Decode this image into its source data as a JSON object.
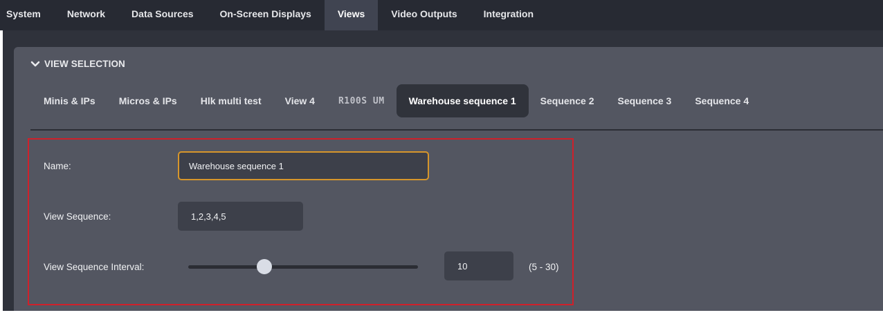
{
  "topnav": {
    "tabs": [
      {
        "label": "System",
        "active": false
      },
      {
        "label": "Network",
        "active": false
      },
      {
        "label": "Data Sources",
        "active": false
      },
      {
        "label": "On-Screen Displays",
        "active": false
      },
      {
        "label": "Views",
        "active": true
      },
      {
        "label": "Video Outputs",
        "active": false
      },
      {
        "label": "Integration",
        "active": false
      }
    ]
  },
  "section": {
    "title": "VIEW SELECTION",
    "icon": "chevron-down-icon"
  },
  "view_tabs": [
    {
      "label": "Minis & IPs",
      "active": false
    },
    {
      "label": "Micros & IPs",
      "active": false
    },
    {
      "label": "Hlk multi test",
      "active": false
    },
    {
      "label": "View 4",
      "active": false
    },
    {
      "label": "R100S UM",
      "active": false
    },
    {
      "label": "Warehouse sequence 1",
      "active": true
    },
    {
      "label": "Sequence 2",
      "active": false
    },
    {
      "label": "Sequence 3",
      "active": false
    },
    {
      "label": "Sequence 4",
      "active": false
    }
  ],
  "form": {
    "name_label": "Name:",
    "name_value": "Warehouse sequence 1",
    "sequence_label": "View Sequence:",
    "sequence_value": "1,2,3,4,5",
    "interval_label": "View Sequence Interval:",
    "interval_value": "10",
    "interval_range": "(5 - 30)",
    "interval_min": 5,
    "interval_max": 30,
    "interval_current": 10
  },
  "colors": {
    "highlight_outline": "#d0202a",
    "focus_border": "#d7962a"
  }
}
